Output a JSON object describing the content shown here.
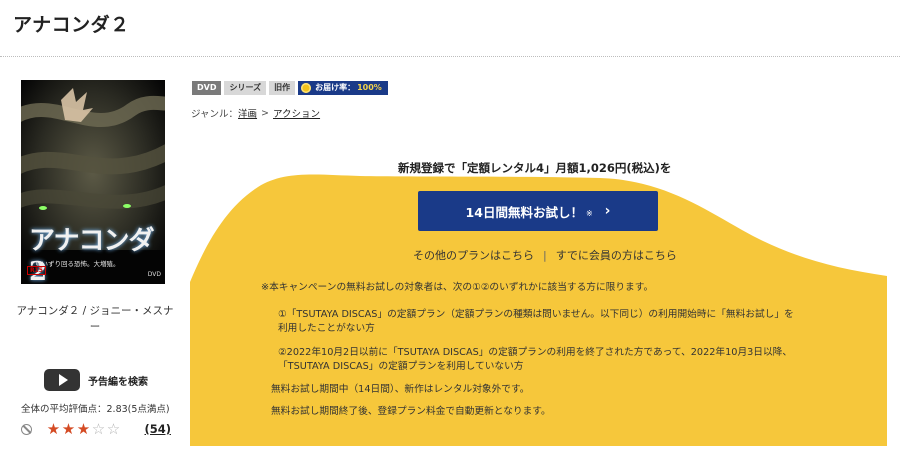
{
  "title": "アナコンダ２",
  "poster": {
    "title_text": "アナコンダ2",
    "tagline": "見いずり回る恐怖。大増殖。",
    "rating_mark": "R15",
    "dvd_mark": "DVD"
  },
  "credit": "アナコンダ２ / ジョニー・メスナー",
  "trailer_label": "予告編を検索",
  "avg_rating": "全体の平均評価点：2.83(5点満点)",
  "stars": {
    "filled": 3,
    "total": 5
  },
  "review_count": "(54)",
  "badges": {
    "dvd": "DVD",
    "series": "シリーズ",
    "old": "旧作",
    "delivery_label": "お届け率：",
    "delivery_value": "100%"
  },
  "genre": {
    "label": "ジャンル：",
    "level1": "洋画",
    "separator": ">",
    "level2": "アクション"
  },
  "campaign": {
    "headline": "新規登録で「定額レンタル4」月額1,026円(税込)を",
    "cta_label": "14日間無料お試し！",
    "cta_note": "※",
    "cta_chevron": "›",
    "link_other_plans": "その他のプランはこちら",
    "link_separator": "|",
    "link_members": "すでに会員の方はこちら",
    "notes": [
      "※本キャンペーンの無料お試しの対象者は、次の①②のいずれかに該当する方に限ります。",
      "①「TSUTAYA DISCAS」の定額プラン（定額プランの種類は問いません。以下同じ）の利用開始時に「無料お試し」を",
      "利用したことがない方",
      "②2022年10月2日以前に「TSUTAYA DISCAS」の定額プランの利用を終了された方であって、2022年10月3日以降、",
      "「TSUTAYA DISCAS」の定額プランを利用していない方",
      "無料お試し期間中（14日間）、新作はレンタル対象外です。",
      "無料お試し期間終了後、登録プラン料金で自動更新となります。"
    ]
  },
  "colors": {
    "campaign_yellow": "#f6c73b",
    "cta_navy": "#1a3a88",
    "star_orange": "#d44b24"
  }
}
